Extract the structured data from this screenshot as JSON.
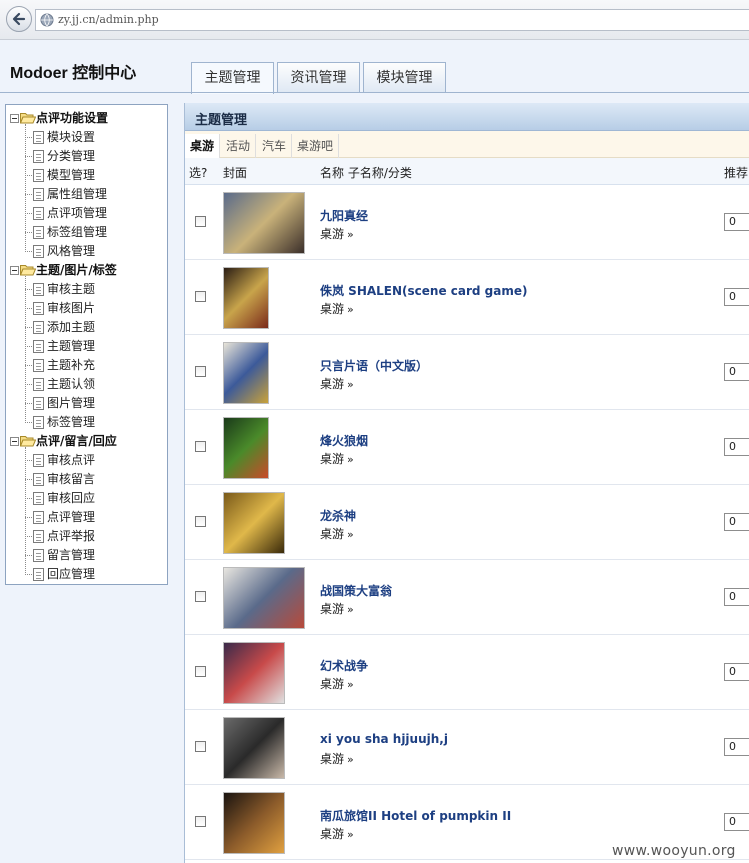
{
  "browser": {
    "url": "zy.jj.cn/admin.php"
  },
  "header": {
    "title": "Modoer 控制中心",
    "tabs": [
      {
        "label": "主题管理",
        "active": true
      },
      {
        "label": "资讯管理",
        "active": false
      },
      {
        "label": "模块管理",
        "active": false
      }
    ]
  },
  "sidebar": {
    "groups": [
      {
        "label": "点评功能设置",
        "items": [
          "模块设置",
          "分类管理",
          "模型管理",
          "属性组管理",
          "点评项管理",
          "标签组管理",
          "风格管理"
        ]
      },
      {
        "label": "主题/图片/标签",
        "items": [
          "审核主题",
          "审核图片",
          "添加主题",
          "主题管理",
          "主题补充",
          "主题认领",
          "图片管理",
          "标签管理"
        ]
      },
      {
        "label": "点评/留言/回应",
        "items": [
          "审核点评",
          "审核留言",
          "审核回应",
          "点评管理",
          "点评举报",
          "留言管理",
          "回应管理"
        ]
      }
    ]
  },
  "panel": {
    "title": "主题管理",
    "subtabs": [
      {
        "label": "桌游",
        "active": true
      },
      {
        "label": "活动",
        "active": false
      },
      {
        "label": "汽车",
        "active": false
      },
      {
        "label": "桌游吧",
        "active": false
      }
    ],
    "columns": {
      "select": "选?",
      "cover": "封面",
      "name": "名称 子名称/分类",
      "recommend": "推荐"
    },
    "rows": [
      {
        "name": "九阳真经",
        "category": "桌游",
        "arrow": "»",
        "recommend": "0"
      },
      {
        "name": "侏岚 SHALEN(scene card game)",
        "category": "桌游",
        "arrow": "»",
        "recommend": "0"
      },
      {
        "name": "只言片语（中文版）",
        "category": "桌游",
        "arrow": "»",
        "recommend": "0"
      },
      {
        "name": "烽火狼烟",
        "category": "桌游",
        "arrow": "»",
        "recommend": "0"
      },
      {
        "name": "龙杀神",
        "category": "桌游",
        "arrow": "»",
        "recommend": "0"
      },
      {
        "name": "战国策大富翁",
        "category": "桌游",
        "arrow": "»",
        "recommend": "0"
      },
      {
        "name": "幻术战争",
        "category": "桌游",
        "arrow": "»",
        "recommend": "0"
      },
      {
        "name": "xi you sha hjjuujh,j",
        "category": "桌游",
        "arrow": "»",
        "recommend": "0"
      },
      {
        "name": "南瓜旅馆II Hotel of pumpkin II",
        "category": "桌游",
        "arrow": "»",
        "recommend": "0"
      }
    ]
  },
  "watermark": "www.wooyun.org"
}
